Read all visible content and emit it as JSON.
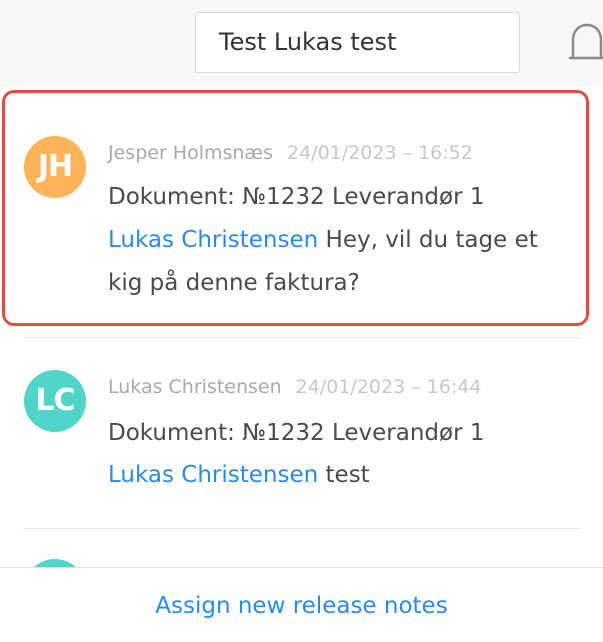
{
  "header": {
    "search_value": "Test Lukas test",
    "bell_icon": "bell-icon"
  },
  "notifications": [
    {
      "initials": "JH",
      "avatar_color": "#ffb45b",
      "author": "Jesper Holmsnæs",
      "date": "24/01/2023 – 16:52",
      "document": "Dokument: №1232 Leverandør 1",
      "mention": "Lukas Christensen",
      "message": "Hey, vil du tage et",
      "message_cont": "kig på denne faktura?",
      "highlighted": true
    },
    {
      "initials": "LC",
      "avatar_color": "#4fd6c8",
      "author": "Lukas Christensen",
      "date": "24/01/2023 – 16:44",
      "document": "Dokument: №1232 Leverandør 1",
      "mention": "Lukas Christensen",
      "message": "test"
    },
    {
      "avatar_color": "#4fd6c8"
    }
  ],
  "footer": {
    "link_label": "Assign new release notes"
  },
  "colors": {
    "highlight_border": "#d9533f",
    "link": "#2b8ae6"
  }
}
